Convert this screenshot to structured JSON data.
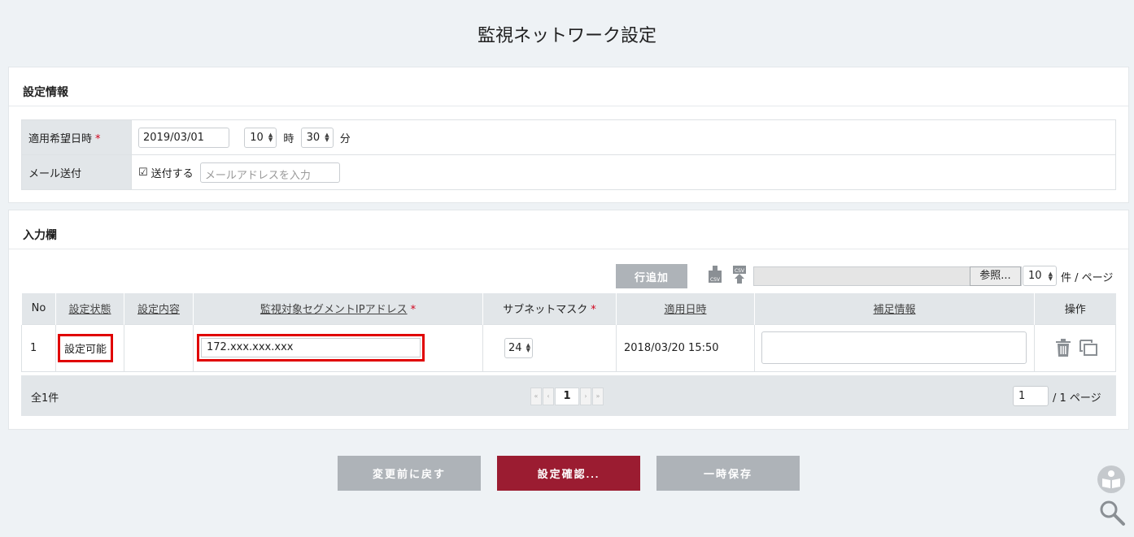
{
  "page": {
    "title": "監視ネットワーク設定"
  },
  "settings": {
    "heading": "設定情報",
    "apply_label": "適用希望日時",
    "required_mark": "*",
    "date_value": "2019/03/01",
    "hour_value": "10",
    "hour_unit": "時",
    "minute_value": "30",
    "minute_unit": "分",
    "mail_label": "メール送付",
    "send_checkbox_label": "送付する",
    "mail_placeholder": "メールアドレスを入力"
  },
  "input": {
    "heading": "入力欄",
    "add_row_label": "行追加",
    "browse_label": "参照...",
    "per_page_value": "10",
    "per_page_unit": "件 / ページ",
    "columns": [
      "No",
      "設定状態",
      "設定内容",
      "監視対象セグメントIPアドレス",
      "サブネットマスク",
      "適用日時",
      "補足情報",
      "操作"
    ],
    "rows": [
      {
        "no": "1",
        "status": "設定可能",
        "content": "",
        "ip": "172.xxx.xxx.xxx",
        "mask": "24",
        "applied": "2018/03/20 15:50",
        "note": ""
      }
    ],
    "total": "全1件",
    "current_page": "1",
    "page_input": "1",
    "page_total": "/  1 ページ"
  },
  "actions": {
    "revert_label": "変更前に戻す",
    "confirm_label": "設定確認...",
    "save_label": "一時保存"
  },
  "colors": {
    "accent": "#9b1c31",
    "required": "#d0021b",
    "highlight": "#e00000"
  }
}
